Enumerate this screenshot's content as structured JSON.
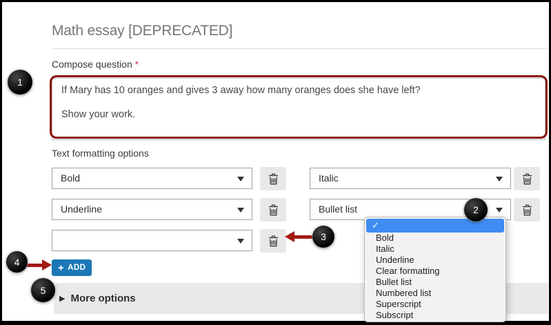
{
  "header": {
    "title": "Math essay [DEPRECATED]"
  },
  "compose": {
    "label": "Compose question",
    "required_mark": "*",
    "text_lines": [
      "If Mary has 10 oranges and gives 3 away how many oranges does she have left?",
      "Show your work."
    ]
  },
  "formatting": {
    "label": "Text formatting options",
    "rows": [
      {
        "left": "Bold",
        "right": "Italic"
      },
      {
        "left": "Underline",
        "right": "Bullet list"
      },
      {
        "left": ""
      }
    ]
  },
  "menu": {
    "check": "✓",
    "items": [
      "",
      "Bold",
      "Italic",
      "Underline",
      "Clear formatting",
      "Bullet list",
      "Numbered list",
      "Superscript",
      "Subscript"
    ]
  },
  "add_button": {
    "plus": "+",
    "label": "ADD"
  },
  "more_options": {
    "arrow": "▶",
    "label": "More options"
  },
  "callouts": {
    "one": "1",
    "two": "2",
    "three": "3",
    "four": "4",
    "five": "5"
  },
  "colors": {
    "annotation_red": "#8a1002",
    "arrow_red": "#a31a10",
    "add_button_blue": "#1b77b5",
    "menu_highlight_blue": "#3f8cf3",
    "required_asterisk_red": "#e0294b",
    "callout_black": "#000000",
    "more_bar_gray": "#e9e9e9"
  }
}
